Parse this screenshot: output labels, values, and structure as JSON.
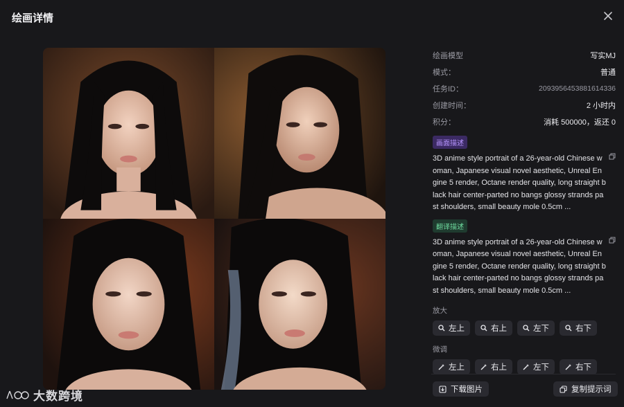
{
  "dialog": {
    "title": "绘画详情"
  },
  "info": {
    "rows": [
      {
        "key": "绘画模型",
        "value": "写实MJ"
      },
      {
        "key": "模式：",
        "value": "普通"
      },
      {
        "key": "任务ID：",
        "value": "2093956453881614336"
      },
      {
        "key": "创建时间：",
        "value": "2 小时内"
      },
      {
        "key": "积分：",
        "value": "消耗 500000，返还 0"
      }
    ],
    "prompt_tag": "画面描述",
    "prompt_text": "3D anime style portrait of a 26-year-old Chinese woman, Japanese visual novel aesthetic, Unreal Engine 5 render, Octane render quality, long straight black hair center-parted no bangs glossy strands past shoulders, small beauty mole 0.5cm ...",
    "translate_tag": "翻译描述",
    "translate_text": "3D anime style portrait of a 26-year-old Chinese woman, Japanese visual novel aesthetic, Unreal Engine 5 render, Octane render quality, long straight black hair center-parted no bangs glossy strands past shoulders, small beauty mole 0.5cm ...",
    "upscale_label": "放大",
    "upscale_buttons": [
      "左上",
      "右上",
      "左下",
      "右下"
    ],
    "vary_label": "微调",
    "vary_buttons": [
      "左上",
      "右上",
      "左下",
      "右下"
    ]
  },
  "actions": {
    "download": "下载图片",
    "copy_prompt": "复制提示词"
  },
  "watermark": {
    "text": "大数跨境"
  },
  "colors": {
    "accent_purple": "#b896ff",
    "accent_green": "#6fdc9f"
  }
}
